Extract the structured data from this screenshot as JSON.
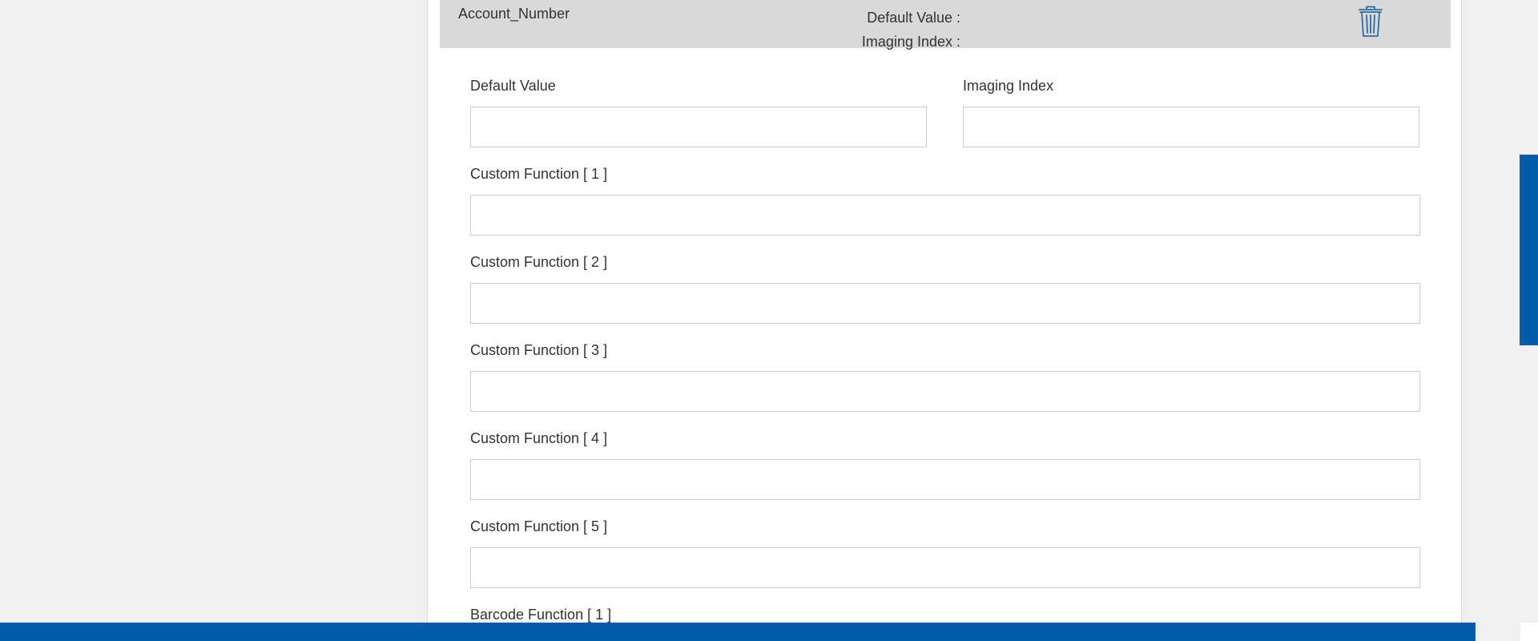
{
  "field": {
    "name": "Account_Number",
    "summary": {
      "default_value_label": "Default Value :",
      "imaging_index_label": "Imaging Index :"
    },
    "delete_icon": "trash-icon"
  },
  "form": {
    "default_value": {
      "label": "Default Value",
      "value": ""
    },
    "imaging_index": {
      "label": "Imaging Index",
      "value": ""
    },
    "custom_functions": [
      {
        "label": "Custom Function [ 1 ]",
        "value": ""
      },
      {
        "label": "Custom Function [ 2 ]",
        "value": ""
      },
      {
        "label": "Custom Function [ 3 ]",
        "value": ""
      },
      {
        "label": "Custom Function [ 4 ]",
        "value": ""
      },
      {
        "label": "Custom Function [ 5 ]",
        "value": ""
      }
    ],
    "barcode_functions": [
      {
        "label": "Barcode Function [ 1 ]"
      }
    ]
  },
  "colors": {
    "accent": "#005ca8",
    "header_bg": "#d9d9d9",
    "page_bg": "#f0f0f0",
    "icon": "#2e6aa3"
  }
}
